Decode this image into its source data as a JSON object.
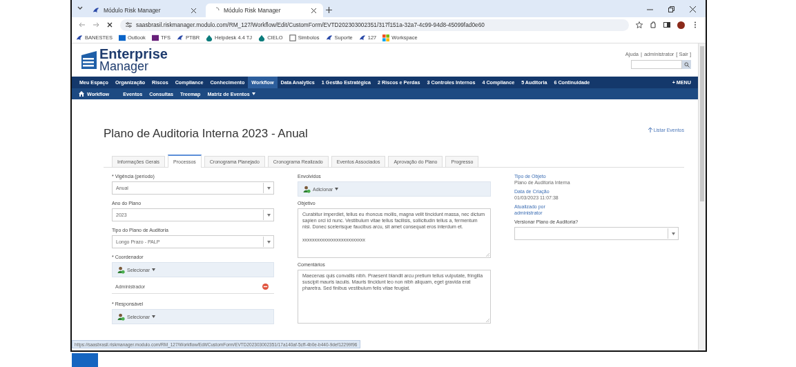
{
  "browser": {
    "tabs": [
      {
        "title": "Módulo Risk Manager",
        "selected": false,
        "loading": false
      },
      {
        "title": "Módulo Risk Manager",
        "selected": true,
        "loading": true
      }
    ],
    "address": "saasbrasil.riskmanager.modulo.com/RM_127/Workflow/Edit/CustomForm/EVTD202303002351/317f151a-32a7-4c99-94d8-45099fad0e60",
    "bookmarks": [
      "BANESTES",
      "Outlook",
      "TFS",
      "PTBR",
      "Helpdesk 4.4 TJ",
      "CIELO",
      "Simbolos",
      "Suporte",
      "127",
      "Workspace"
    ],
    "status_url": "https://saasbrasil.riskmanager.modulo.com/RM_127/Workflow/Edit/CustomForm/EVTD202303002351/17a140af-5cff-4b0e-b440-9def12299f96"
  },
  "app": {
    "logo": {
      "line1": "Enterprise",
      "line2": "Manager"
    },
    "header": {
      "help": "Ajuda",
      "separator": "|",
      "user": "administrator",
      "exit": "[ Sair ]"
    },
    "nav": [
      {
        "label": "Meu Espaço",
        "selected": false
      },
      {
        "label": "Organização",
        "selected": false
      },
      {
        "label": "Riscos",
        "selected": false
      },
      {
        "label": "Compliance",
        "selected": false
      },
      {
        "label": "Conhecimento",
        "selected": false
      },
      {
        "label": "Workflow",
        "selected": true
      },
      {
        "label": "Data Analytics",
        "selected": false
      },
      {
        "label": "1 Gestão Estratégica",
        "selected": false
      },
      {
        "label": "2 Riscos e Perdas",
        "selected": false
      },
      {
        "label": "3 Controles Internos",
        "selected": false
      },
      {
        "label": "4 Compliance",
        "selected": false
      },
      {
        "label": "5 Auditoria",
        "selected": false
      },
      {
        "label": "6 Continuidade",
        "selected": false
      }
    ],
    "menu_button": "+ MENU",
    "subnav_home": "Workflow",
    "subnav": [
      {
        "label": "Eventos",
        "dropdown": false
      },
      {
        "label": "Consultas",
        "dropdown": false
      },
      {
        "label": "Treemap",
        "dropdown": false
      },
      {
        "label": "Matriz de Eventos",
        "dropdown": true
      }
    ],
    "title": "Plano de Auditoria Interna 2023 - Anual",
    "list_link": "Listar Eventos",
    "tabs": [
      {
        "label": "Informações Gerais",
        "selected": false
      },
      {
        "label": "Processos",
        "selected": true
      },
      {
        "label": "Cronograma Planejado",
        "selected": false
      },
      {
        "label": "Cronograma Realizado",
        "selected": false
      },
      {
        "label": "Eventos Associados",
        "selected": false
      },
      {
        "label": "Aprovação do Plano",
        "selected": false
      },
      {
        "label": "Progresso",
        "selected": false
      }
    ],
    "left": [
      {
        "kind": "select",
        "label": "* Vigência (período)",
        "value": "Anual"
      },
      {
        "kind": "select",
        "label": "Ano do Plano",
        "value": "2023"
      },
      {
        "kind": "select",
        "label": "Tipo do Plano de Auditoria",
        "value": "Longo Prazo - PALP"
      },
      {
        "kind": "picker",
        "label": "* Coordenador",
        "button": "Selecionar",
        "value": "Administrador"
      },
      {
        "kind": "picker",
        "label": "* Responsável",
        "button": "Selecionar"
      }
    ],
    "middle": [
      {
        "kind": "picker",
        "label": "Envolvidos",
        "button": "Adicionar"
      },
      {
        "kind": "textarea",
        "label": "Objetivo",
        "lines": [
          "Curabitur imperdiet, tellus eu rhoncus mollis, magna velit tincidunt massa, nec dictum sapien orci id nunc. Vestibulum vitae tellus facilisis, sollicitudin tellus a, fermentum nisi. Donec scelerisque faucibus arcu, sit amet consequat eros interdum et.",
          "xxxxxxxxxxxxxxxxxxxxxxxxxx"
        ]
      },
      {
        "kind": "textarea",
        "label": "Comentários",
        "lines": [
          "Maecenas quis convallis nibh. Praesent blandit arcu pretium tellus vulputate, fringilla suscipit mauris iaculis. Mauris tincidunt leo non nibh aliquam, eget gravida erat pharetra. Sed finibus vestibulum felis vitae feugiat."
        ]
      }
    ],
    "right": [
      {
        "kind": "info",
        "label": "Tipo de Objeto",
        "value": "Plano de Auditoria Interna"
      },
      {
        "kind": "info",
        "label": "Data de Criação",
        "value": "01/03/2023 11:07:38"
      },
      {
        "kind": "link",
        "label": "Atualizado por",
        "value": "administrator"
      },
      {
        "kind": "select",
        "label": "Versionar Plano de Auditoria?"
      }
    ]
  }
}
